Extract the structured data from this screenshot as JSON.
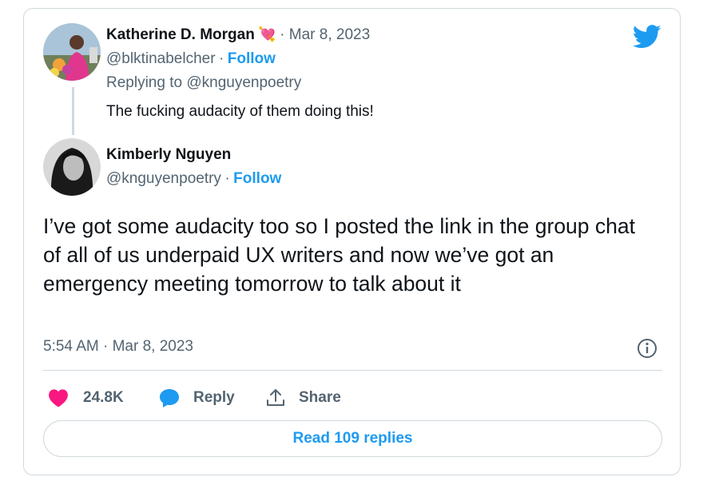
{
  "tweet_parent": {
    "author_name": "Katherine D. Morgan",
    "author_emoji": "💘",
    "date": "· Mar 8, 2023",
    "handle": "@blktinabelcher",
    "separator": "·",
    "follow_label": "Follow",
    "replying_to": "Replying to @knguyenpoetry",
    "text": "The fucking audacity of them doing this!"
  },
  "tweet_main": {
    "author_name": "Kimberly Nguyen",
    "handle": "@knguyenpoetry",
    "separator": "·",
    "follow_label": "Follow",
    "text": "I’ve got some audacity too so I posted the link in the group chat of all of us underpaid UX writers and now we’ve got an emergency meeting tomorrow to talk about it",
    "timestamp": "5:54 AM · Mar 8, 2023"
  },
  "actions": {
    "likes_count": "24.8K",
    "reply_label": "Reply",
    "share_label": "Share"
  },
  "read_replies_label": "Read 109 replies",
  "colors": {
    "accent": "#1d9bf0",
    "heart": "#f91880",
    "muted": "#536471",
    "border": "#cfd9de"
  },
  "icons": [
    "twitter-bird-icon",
    "heart-icon",
    "reply-bubble-icon",
    "share-icon",
    "info-icon"
  ]
}
